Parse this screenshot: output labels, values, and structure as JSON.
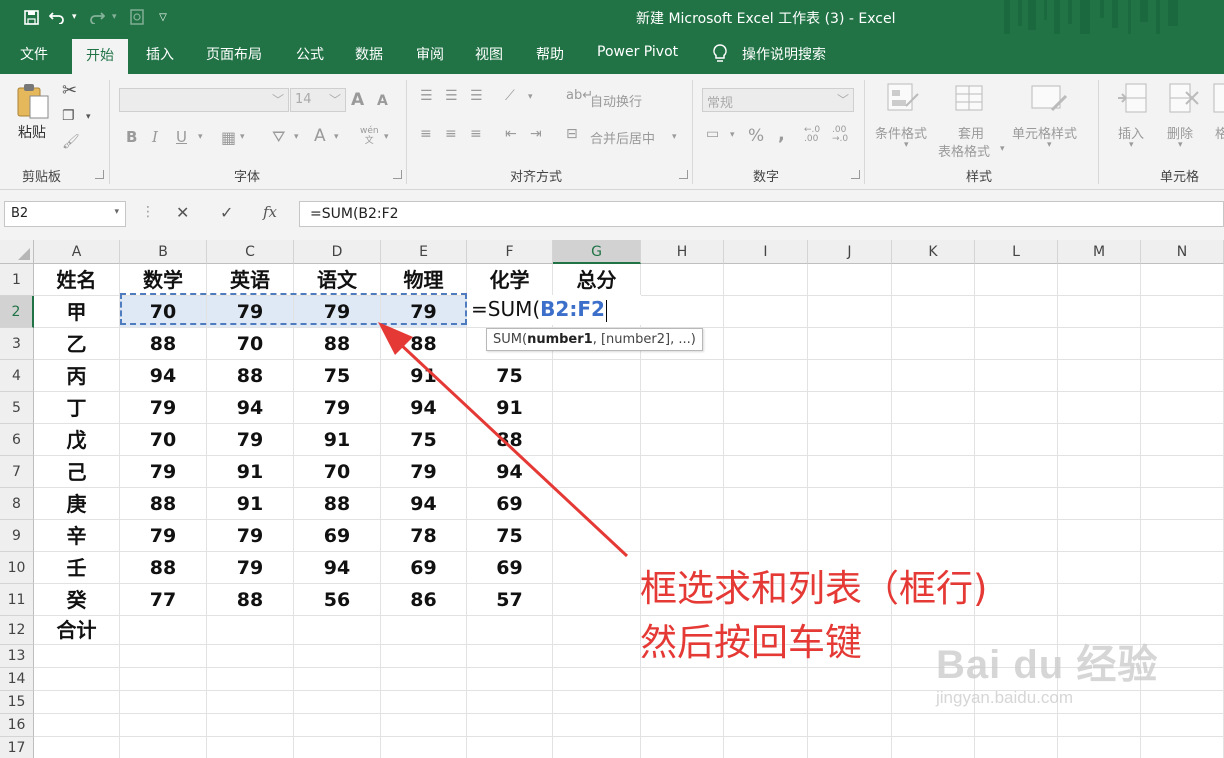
{
  "window": {
    "title": "新建 Microsoft Excel 工作表 (3)  -  Excel"
  },
  "quick_access": {
    "save_icon": "save-icon",
    "undo_icon": "undo-icon",
    "redo_icon": "redo-icon",
    "print_preview_icon": "print-preview-icon",
    "customize_icon": "customize-qat-icon"
  },
  "ribbon_tabs": [
    "文件",
    "开始",
    "插入",
    "页面布局",
    "公式",
    "数据",
    "审阅",
    "视图",
    "帮助",
    "Power Pivot",
    "操作说明搜索"
  ],
  "ribbon": {
    "clipboard": {
      "label": "剪贴板",
      "paste": "粘贴"
    },
    "font": {
      "label": "字体",
      "font_name": "",
      "font_size": "14",
      "bold": "B",
      "italic": "I",
      "underline": "U",
      "font_color": "A",
      "grow": "A",
      "shrink": "A",
      "wen": "wén\n文"
    },
    "alignment": {
      "label": "对齐方式",
      "wrap": "自动换行",
      "merge": "合并后居中"
    },
    "number": {
      "label": "数字",
      "format": "常规",
      "percent": "%",
      "comma": ","
    },
    "styles": {
      "label": "样式",
      "conditional": "条件格式",
      "table_1": "套用",
      "table_2": "表格格式",
      "cell_styles": "单元格样式"
    },
    "cells": {
      "label": "单元格",
      "insert": "插入",
      "delete": "删除",
      "format_partial": "格"
    }
  },
  "formula_bar": {
    "name_box": "B2",
    "formula": "=SUM(B2:F2",
    "cancel": "✕",
    "enter": "✓",
    "fx": "fx"
  },
  "columns": [
    "A",
    "B",
    "C",
    "D",
    "E",
    "F",
    "G",
    "H",
    "I",
    "J",
    "K",
    "L",
    "M",
    "N"
  ],
  "rows": [
    "1",
    "2",
    "3",
    "4",
    "5",
    "6",
    "7",
    "8",
    "9",
    "10",
    "11",
    "12",
    "13",
    "14",
    "15",
    "16",
    "17"
  ],
  "sheet": {
    "headers": [
      "姓名",
      "数学",
      "英语",
      "语文",
      "物理",
      "化学",
      "总分"
    ],
    "data": [
      [
        "甲",
        "70",
        "79",
        "79",
        "79",
        ""
      ],
      [
        "乙",
        "88",
        "70",
        "88",
        "88",
        ""
      ],
      [
        "丙",
        "94",
        "88",
        "75",
        "91",
        "75"
      ],
      [
        "丁",
        "79",
        "94",
        "79",
        "94",
        "91"
      ],
      [
        "戊",
        "70",
        "79",
        "91",
        "75",
        "88"
      ],
      [
        "己",
        "79",
        "91",
        "70",
        "79",
        "94"
      ],
      [
        "庚",
        "88",
        "91",
        "88",
        "94",
        "69"
      ],
      [
        "辛",
        "79",
        "79",
        "69",
        "78",
        "75"
      ],
      [
        "壬",
        "88",
        "79",
        "94",
        "69",
        "69"
      ],
      [
        "癸",
        "77",
        "88",
        "56",
        "86",
        "57"
      ]
    ],
    "total_label": "合计"
  },
  "edit_cell": {
    "prefix": "=SUM(",
    "ref": "B2:F2"
  },
  "tooltip": {
    "fn": "SUM(",
    "arg1": "number1",
    "rest": ", [number2], ...)"
  },
  "annotation": {
    "line1": "框选求和列表（框行)",
    "line2": "然后按回车键",
    "color": "#e53935"
  },
  "watermark": {
    "logo": "Bai du 经验",
    "url": "jingyan.baidu.com"
  },
  "colors": {
    "excel_green": "#217346",
    "selection_blue": "#4f7bbf",
    "ref_blue": "#3b6fc9"
  }
}
